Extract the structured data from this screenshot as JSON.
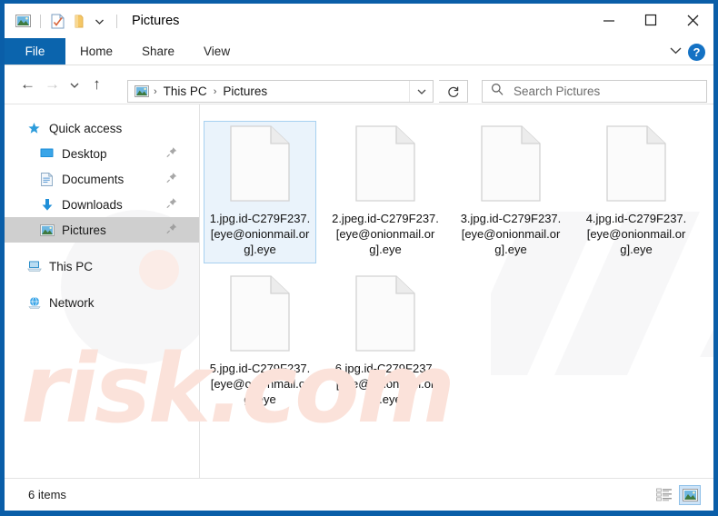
{
  "window": {
    "title": "Pictures",
    "accent_color": "#0a5ea8",
    "controls": {
      "minimize": "–",
      "maximize": "□",
      "close": "✕"
    },
    "quick_access_toolbar": [
      {
        "name": "pictures-folder-icon",
        "label": "Pictures"
      },
      {
        "name": "properties-icon",
        "label": "Properties"
      },
      {
        "name": "new-folder-icon",
        "label": "New folder"
      },
      {
        "name": "customize-dropdown-icon",
        "label": "Customize Quick Access Toolbar"
      }
    ]
  },
  "ribbon": {
    "tabs": [
      {
        "label": "File",
        "active": true
      },
      {
        "label": "Home",
        "active": false
      },
      {
        "label": "Share",
        "active": false
      },
      {
        "label": "View",
        "active": false
      }
    ],
    "expand_label": "⌄",
    "help_label": "?"
  },
  "navigation": {
    "back_label": "←",
    "forward_label": "→",
    "recent_label": "⌄",
    "up_label": "↑"
  },
  "address": {
    "icon": "pictures-folder-icon",
    "crumbs": [
      "This PC",
      "Pictures"
    ],
    "separator": "›",
    "dropdown": "⌄",
    "refresh": "↻"
  },
  "search": {
    "placeholder": "Search Pictures",
    "icon": "search-icon"
  },
  "sidebar": {
    "items": [
      {
        "label": "Quick access",
        "icon": "star-pin-icon",
        "level": 0,
        "selected": false,
        "pinned": false,
        "spaced": false
      },
      {
        "label": "Desktop",
        "icon": "desktop-icon",
        "level": 1,
        "selected": false,
        "pinned": true,
        "spaced": false
      },
      {
        "label": "Documents",
        "icon": "documents-icon",
        "level": 1,
        "selected": false,
        "pinned": true,
        "spaced": false
      },
      {
        "label": "Downloads",
        "icon": "downloads-icon",
        "level": 1,
        "selected": false,
        "pinned": true,
        "spaced": false
      },
      {
        "label": "Pictures",
        "icon": "pictures-icon",
        "level": 1,
        "selected": true,
        "pinned": true,
        "spaced": false
      },
      {
        "label": "This PC",
        "icon": "this-pc-icon",
        "level": 0,
        "selected": false,
        "pinned": false,
        "spaced": true
      },
      {
        "label": "Network",
        "icon": "network-icon",
        "level": 0,
        "selected": false,
        "pinned": false,
        "spaced": true
      }
    ]
  },
  "files": [
    {
      "name": "1.jpg.id-C279F237.[eye@onionmail.org].eye",
      "selected": true
    },
    {
      "name": "2.jpeg.id-C279F237.[eye@onionmail.org].eye",
      "selected": false
    },
    {
      "name": "3.jpg.id-C279F237.[eye@onionmail.org].eye",
      "selected": false
    },
    {
      "name": "4.jpg.id-C279F237.[eye@onionmail.org].eye",
      "selected": false
    },
    {
      "name": "5.jpg.id-C279F237.[eye@onionmail.org].eye",
      "selected": false
    },
    {
      "name": "6.jpg.id-C279F237.[eye@onionmail.org].eye",
      "selected": false
    }
  ],
  "status": {
    "item_count": "6 items",
    "views": [
      {
        "name": "details-view-button",
        "active": false
      },
      {
        "name": "large-icons-view-button",
        "active": true
      }
    ]
  },
  "watermark": {
    "text": "risk.com",
    "color": "#fbe2da"
  }
}
